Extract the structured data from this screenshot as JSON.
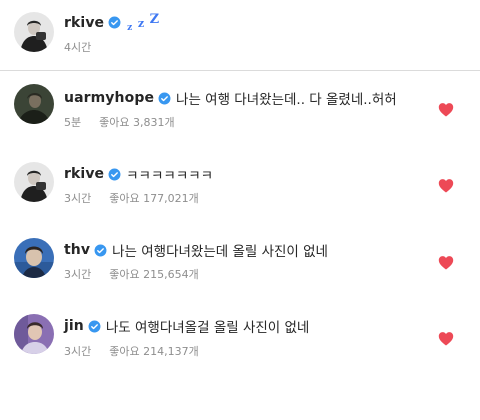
{
  "post": {
    "username": "rkive",
    "time": "4시간",
    "zzz": [
      "z",
      "z",
      "Z"
    ]
  },
  "comments": [
    {
      "username": "uarmyhope",
      "text": "나는 여행 다녀왔는데.. 다 올렸네..허허",
      "time": "5분",
      "likes": "좋아요 3,831개"
    },
    {
      "username": "rkive",
      "text": "ㅋㅋㅋㅋㅋㅋㅋ",
      "time": "3시간",
      "likes": "좋아요 177,021개"
    },
    {
      "username": "thv",
      "text": "나는 여행다녀왔는데 올릴 사진이 없네",
      "time": "3시간",
      "likes": "좋아요 215,654개"
    },
    {
      "username": "jin",
      "text": "나도 여행다녀올걸 올릴 사진이 없네",
      "time": "3시간",
      "likes": "좋아요 214,137개"
    }
  ],
  "icons": {
    "verified": "verified-badge-icon",
    "like": "heart-icon"
  },
  "colors": {
    "verified": "#3897f0",
    "heart": "#ed4956",
    "meta": "#8e8e8e",
    "divider": "#dbdbdb",
    "zzz": "#3f78f2"
  }
}
